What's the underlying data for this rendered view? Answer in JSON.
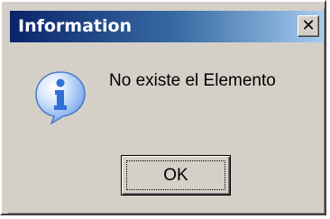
{
  "dialog": {
    "title": "Information",
    "close_label": "✕",
    "icon": "information-icon",
    "message": "No existe el Elemento",
    "ok_label": "OK"
  },
  "colors": {
    "titlebar_start": "#0a246a",
    "titlebar_end": "#a6caf0",
    "face": "#d4d0c8",
    "icon_blue": "#2f6fd6"
  }
}
